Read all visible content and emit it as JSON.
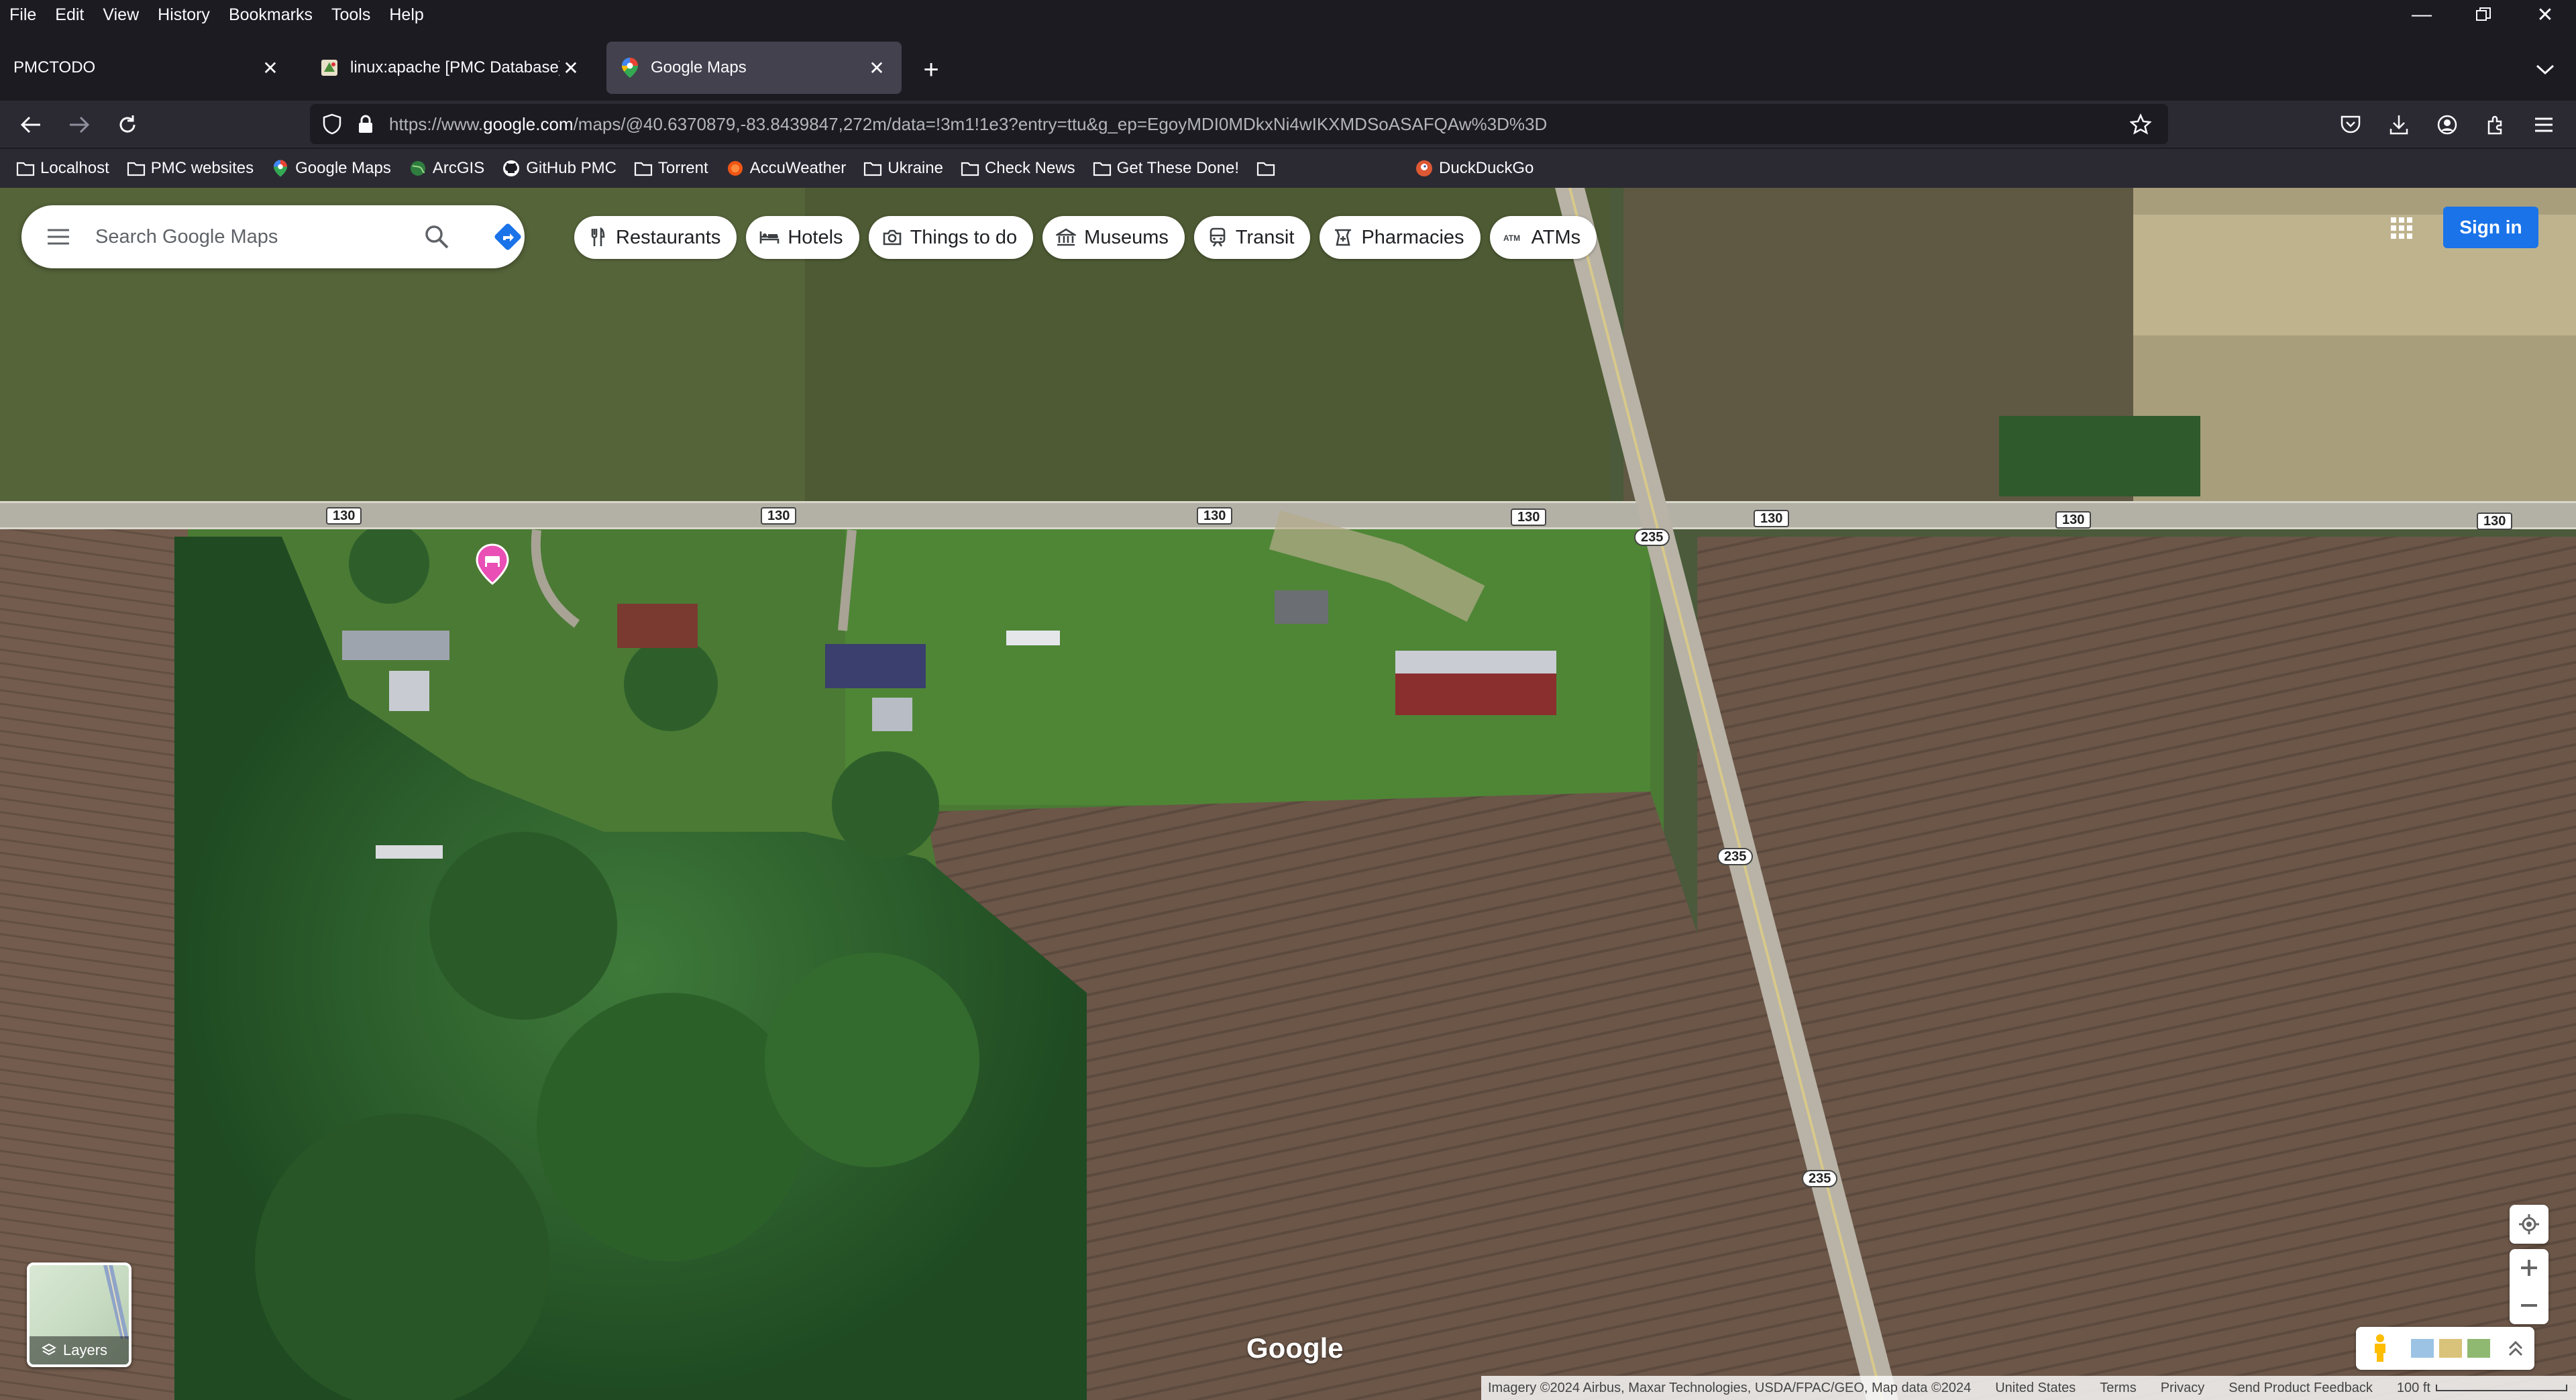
{
  "menubar": {
    "items": [
      "File",
      "Edit",
      "View",
      "History",
      "Bookmarks",
      "Tools",
      "Help"
    ]
  },
  "tabs": [
    {
      "title": "PMCTODO",
      "active": false
    },
    {
      "title": "linux:apache [PMC Database]",
      "active": false
    },
    {
      "title": "Google Maps",
      "active": true
    }
  ],
  "address_bar": {
    "url_prefix": "https://www.",
    "url_domain": "google.com",
    "url_suffix": "/maps/@40.6370879,-83.8439847,272m/data=!3m1!1e3?entry=ttu&g_ep=EgoyMDI0MDkxNi4wIKXMDSoASAFQAw%3D%3D"
  },
  "bookmarks": [
    {
      "label": "Localhost",
      "icon": "folder-icon"
    },
    {
      "label": "PMC websites",
      "icon": "folder-icon"
    },
    {
      "label": "Google Maps",
      "icon": "maps-pin-icon"
    },
    {
      "label": "ArcGIS",
      "icon": "globe-icon"
    },
    {
      "label": "GitHub PMC",
      "icon": "github-icon"
    },
    {
      "label": "Torrent",
      "icon": "folder-icon"
    },
    {
      "label": "AccuWeather",
      "icon": "sun-icon"
    },
    {
      "label": "Ukraine",
      "icon": "folder-icon"
    },
    {
      "label": "Check News",
      "icon": "folder-icon"
    },
    {
      "label": "Get These Done!",
      "icon": "folder-icon"
    },
    {
      "label": "",
      "icon": "folder-icon"
    },
    {
      "label": "DuckDuckGo",
      "icon": "duckduckgo-icon"
    }
  ],
  "maps": {
    "search_placeholder": "Search Google Maps",
    "chips": [
      {
        "label": "Restaurants",
        "icon": "fork-knife-icon"
      },
      {
        "label": "Hotels",
        "icon": "bed-icon"
      },
      {
        "label": "Things to do",
        "icon": "camera-icon"
      },
      {
        "label": "Museums",
        "icon": "museum-icon"
      },
      {
        "label": "Transit",
        "icon": "train-icon"
      },
      {
        "label": "Pharmacies",
        "icon": "pharmacy-icon"
      },
      {
        "label": "ATMs",
        "icon": "atm-icon"
      }
    ],
    "sign_in_label": "Sign in",
    "layers_label": "Layers",
    "logo_text": "Google",
    "road_labels": {
      "route_130": "130",
      "route_235": "235"
    },
    "attribution": {
      "imagery": "Imagery ©2024 Airbus, Maxar Technologies, USDA/FPAC/GEO, Map data ©2024",
      "country": "United States",
      "terms": "Terms",
      "privacy": "Privacy",
      "feedback": "Send Product Feedback",
      "scale": "100 ft"
    }
  },
  "colors": {
    "chrome_bg": "#1c1b22",
    "toolbar_bg": "#2b2a33",
    "active_tab": "#42414d",
    "signin_blue": "#1a73e8",
    "poi_pink": "#e94fb4"
  }
}
